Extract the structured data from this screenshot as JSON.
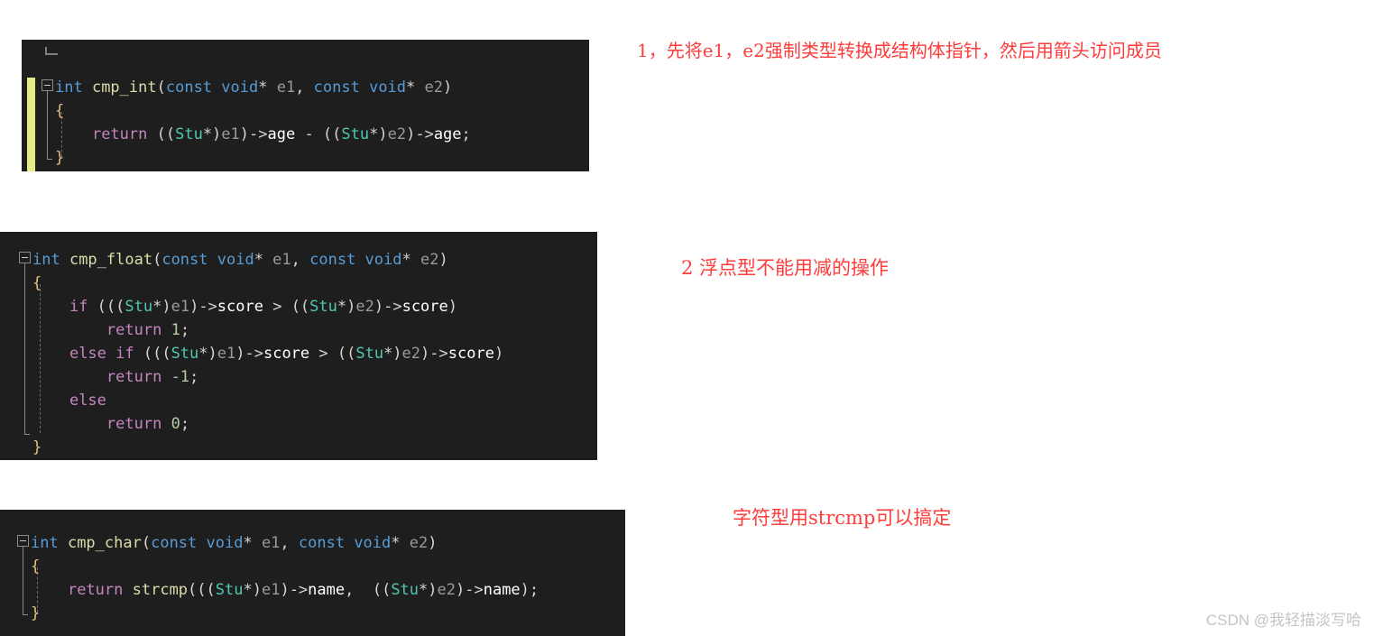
{
  "page": {
    "background": "#ffffff",
    "watermark": "CSDN @我轻描淡写哈"
  },
  "theme": {
    "code_background": "#1e1e1e",
    "default_text": "#d4d4d4",
    "keyword": "#569cd6",
    "function": "#dcdcaa",
    "control": "#c586c0",
    "type": "#4ec9b0",
    "variable": "#9cdcfe",
    "number": "#b5cea8",
    "member": "#ffffff",
    "change_bar": "#e8ea86",
    "annotation": "#ff3b3b"
  },
  "code_blocks": [
    {
      "id": "cmp-int",
      "lines": [
        [
          {
            "t": "int ",
            "c": "kw"
          },
          {
            "t": "cmp_int",
            "c": "fn"
          },
          {
            "t": "(",
            "c": "pun"
          },
          {
            "t": "const void",
            "c": "kw"
          },
          {
            "t": "* ",
            "c": "pun"
          },
          {
            "t": "e1",
            "c": "gry"
          },
          {
            "t": ", ",
            "c": "pun"
          },
          {
            "t": "const void",
            "c": "kw"
          },
          {
            "t": "* ",
            "c": "pun"
          },
          {
            "t": "e2",
            "c": "gry"
          },
          {
            "t": ")",
            "c": "pun"
          }
        ],
        [
          {
            "t": "{",
            "c": "brc"
          }
        ],
        [
          {
            "t": "    ",
            "c": "pun"
          },
          {
            "t": "return",
            "c": "ctl"
          },
          {
            "t": " ((",
            "c": "pun"
          },
          {
            "t": "Stu",
            "c": "typ"
          },
          {
            "t": "*)",
            "c": "pun"
          },
          {
            "t": "e1",
            "c": "gry"
          },
          {
            "t": ")->",
            "c": "pun"
          },
          {
            "t": "age",
            "c": "mem"
          },
          {
            "t": " - ((",
            "c": "pun"
          },
          {
            "t": "Stu",
            "c": "typ"
          },
          {
            "t": "*)",
            "c": "pun"
          },
          {
            "t": "e2",
            "c": "gry"
          },
          {
            "t": ")->",
            "c": "pun"
          },
          {
            "t": "age",
            "c": "mem"
          },
          {
            "t": ";",
            "c": "pun"
          }
        ],
        [
          {
            "t": "}",
            "c": "brc"
          }
        ]
      ]
    },
    {
      "id": "cmp-float",
      "lines": [
        [
          {
            "t": "int ",
            "c": "kw"
          },
          {
            "t": "cmp_float",
            "c": "fn"
          },
          {
            "t": "(",
            "c": "pun"
          },
          {
            "t": "const void",
            "c": "kw"
          },
          {
            "t": "* ",
            "c": "pun"
          },
          {
            "t": "e1",
            "c": "gry"
          },
          {
            "t": ", ",
            "c": "pun"
          },
          {
            "t": "const void",
            "c": "kw"
          },
          {
            "t": "* ",
            "c": "pun"
          },
          {
            "t": "e2",
            "c": "gry"
          },
          {
            "t": ")",
            "c": "pun"
          }
        ],
        [
          {
            "t": "{",
            "c": "brc"
          }
        ],
        [
          {
            "t": "    ",
            "c": "pun"
          },
          {
            "t": "if",
            "c": "ctl"
          },
          {
            "t": " (((",
            "c": "pun"
          },
          {
            "t": "Stu",
            "c": "typ"
          },
          {
            "t": "*)",
            "c": "pun"
          },
          {
            "t": "e1",
            "c": "gry"
          },
          {
            "t": ")->",
            "c": "pun"
          },
          {
            "t": "score",
            "c": "mem"
          },
          {
            "t": " > ((",
            "c": "pun"
          },
          {
            "t": "Stu",
            "c": "typ"
          },
          {
            "t": "*)",
            "c": "pun"
          },
          {
            "t": "e2",
            "c": "gry"
          },
          {
            "t": ")->",
            "c": "pun"
          },
          {
            "t": "score",
            "c": "mem"
          },
          {
            "t": ")",
            "c": "pun"
          }
        ],
        [
          {
            "t": "        ",
            "c": "pun"
          },
          {
            "t": "return",
            "c": "ctl"
          },
          {
            "t": " ",
            "c": "pun"
          },
          {
            "t": "1",
            "c": "num"
          },
          {
            "t": ";",
            "c": "pun"
          }
        ],
        [
          {
            "t": "    ",
            "c": "pun"
          },
          {
            "t": "else if",
            "c": "ctl"
          },
          {
            "t": " (((",
            "c": "pun"
          },
          {
            "t": "Stu",
            "c": "typ"
          },
          {
            "t": "*)",
            "c": "pun"
          },
          {
            "t": "e1",
            "c": "gry"
          },
          {
            "t": ")->",
            "c": "pun"
          },
          {
            "t": "score",
            "c": "mem"
          },
          {
            "t": " > ((",
            "c": "pun"
          },
          {
            "t": "Stu",
            "c": "typ"
          },
          {
            "t": "*)",
            "c": "pun"
          },
          {
            "t": "e2",
            "c": "gry"
          },
          {
            "t": ")->",
            "c": "pun"
          },
          {
            "t": "score",
            "c": "mem"
          },
          {
            "t": ")",
            "c": "pun"
          }
        ],
        [
          {
            "t": "        ",
            "c": "pun"
          },
          {
            "t": "return",
            "c": "ctl"
          },
          {
            "t": " ",
            "c": "pun"
          },
          {
            "t": "-1",
            "c": "num"
          },
          {
            "t": ";",
            "c": "pun"
          }
        ],
        [
          {
            "t": "    ",
            "c": "pun"
          },
          {
            "t": "else",
            "c": "ctl"
          }
        ],
        [
          {
            "t": "        ",
            "c": "pun"
          },
          {
            "t": "return",
            "c": "ctl"
          },
          {
            "t": " ",
            "c": "pun"
          },
          {
            "t": "0",
            "c": "num"
          },
          {
            "t": ";",
            "c": "pun"
          }
        ],
        [
          {
            "t": "}",
            "c": "brc"
          }
        ]
      ]
    },
    {
      "id": "cmp-char",
      "lines": [
        [
          {
            "t": "int ",
            "c": "kw"
          },
          {
            "t": "cmp_char",
            "c": "fn"
          },
          {
            "t": "(",
            "c": "pun"
          },
          {
            "t": "const void",
            "c": "kw"
          },
          {
            "t": "* ",
            "c": "pun"
          },
          {
            "t": "e1",
            "c": "gry"
          },
          {
            "t": ", ",
            "c": "pun"
          },
          {
            "t": "const void",
            "c": "kw"
          },
          {
            "t": "* ",
            "c": "pun"
          },
          {
            "t": "e2",
            "c": "gry"
          },
          {
            "t": ")",
            "c": "pun"
          }
        ],
        [
          {
            "t": "{",
            "c": "brc"
          }
        ],
        [
          {
            "t": "    ",
            "c": "pun"
          },
          {
            "t": "return",
            "c": "ctl"
          },
          {
            "t": " ",
            "c": "pun"
          },
          {
            "t": "strcmp",
            "c": "fn"
          },
          {
            "t": "(((",
            "c": "pun"
          },
          {
            "t": "Stu",
            "c": "typ"
          },
          {
            "t": "*)",
            "c": "pun"
          },
          {
            "t": "e1",
            "c": "gry"
          },
          {
            "t": ")->",
            "c": "pun"
          },
          {
            "t": "name",
            "c": "mem"
          },
          {
            "t": ",  ((",
            "c": "pun"
          },
          {
            "t": "Stu",
            "c": "typ"
          },
          {
            "t": "*)",
            "c": "pun"
          },
          {
            "t": "e2",
            "c": "gry"
          },
          {
            "t": ")->",
            "c": "pun"
          },
          {
            "t": "name",
            "c": "mem"
          },
          {
            "t": ");",
            "c": "pun"
          }
        ],
        [
          {
            "t": "}",
            "c": "brc"
          }
        ]
      ]
    }
  ],
  "annotations": {
    "note_1": "1，先将e1，e2强制类型转换成结构体指针，然后用箭头访问成员",
    "note_2": "2 浮点型不能用减的操作",
    "note_3": "字符型用strcmp可以搞定"
  }
}
